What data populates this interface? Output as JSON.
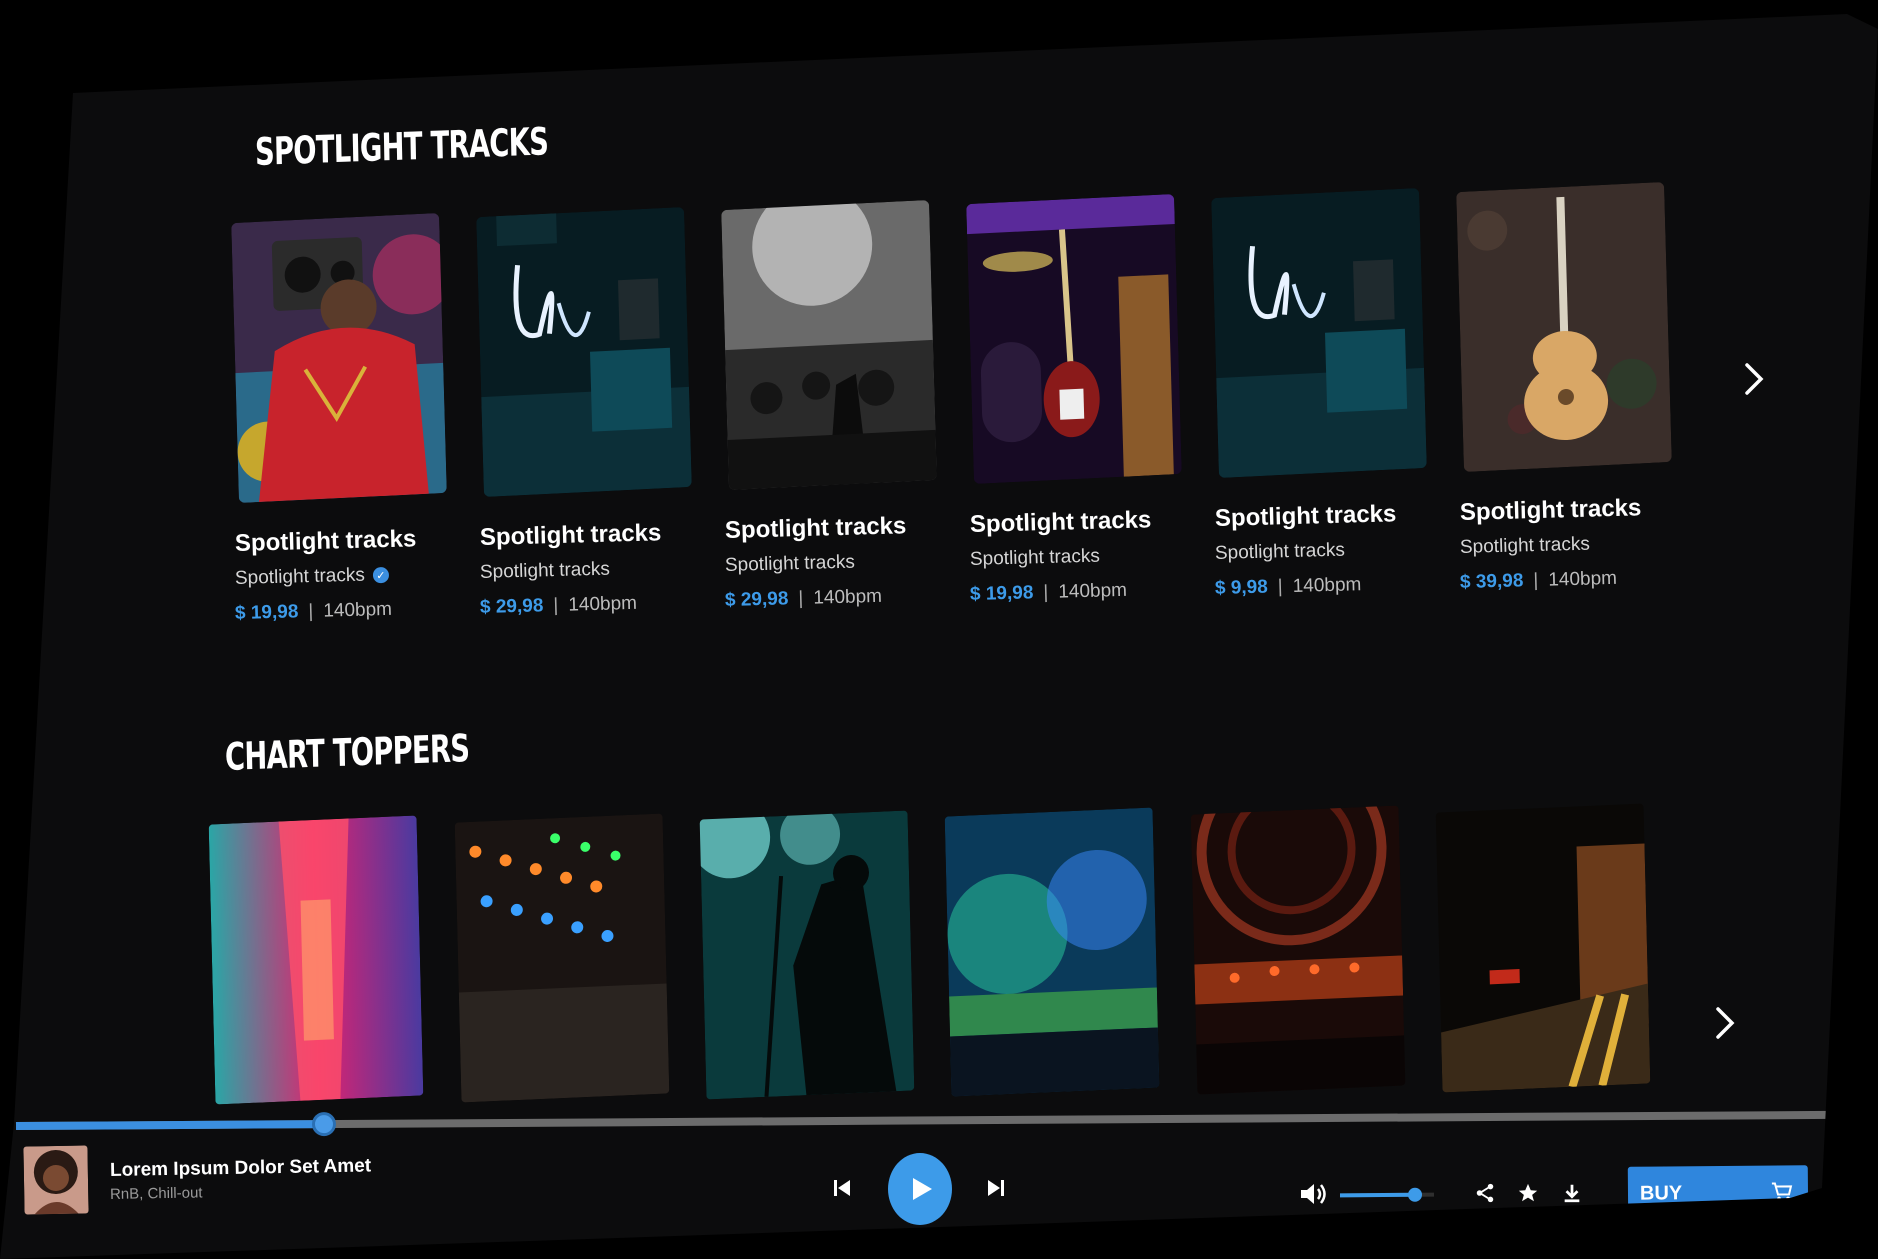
{
  "sections": {
    "spotlight": {
      "title": "SPOTLIGHT TRACKS"
    },
    "chart": {
      "title": "CHART TOPPERS"
    }
  },
  "spotlight_cards": [
    {
      "title": "Spotlight tracks",
      "artist": "Spotlight tracks",
      "price": "$ 19,98",
      "bpm": "140bpm",
      "verified": true
    },
    {
      "title": "Spotlight tracks",
      "artist": "Spotlight tracks",
      "price": "$ 29,98",
      "bpm": "140bpm"
    },
    {
      "title": "Spotlight tracks",
      "artist": "Spotlight tracks",
      "price": "$ 29,98",
      "bpm": "140bpm"
    },
    {
      "title": "Spotlight tracks",
      "artist": "Spotlight tracks",
      "price": "$ 19,98",
      "bpm": "140bpm"
    },
    {
      "title": "Spotlight tracks",
      "artist": "Spotlight tracks",
      "price": "$ 9,98",
      "bpm": "140bpm"
    },
    {
      "title": "Spotlight tracks",
      "artist": "Spotlight tracks",
      "price": "$ 39,98",
      "bpm": "140bpm"
    }
  ],
  "separator": "|",
  "player": {
    "track_title": "Lorem Ipsum Dolor Set Amet",
    "genre": "RnB, Chill-out",
    "progress": 0.17,
    "volume": 0.8,
    "buy_label": "BUY"
  },
  "icons": {
    "next": "chevron-right-icon",
    "prev_track": "skip-previous-icon",
    "play": "play-icon",
    "next_track": "skip-next-icon",
    "volume": "volume-icon",
    "share": "share-icon",
    "favorite": "star-icon",
    "download": "download-icon",
    "cart": "cart-icon",
    "verified": "verified-icon"
  },
  "colors": {
    "accent": "#3d9be9",
    "background": "#0c0c0d"
  }
}
